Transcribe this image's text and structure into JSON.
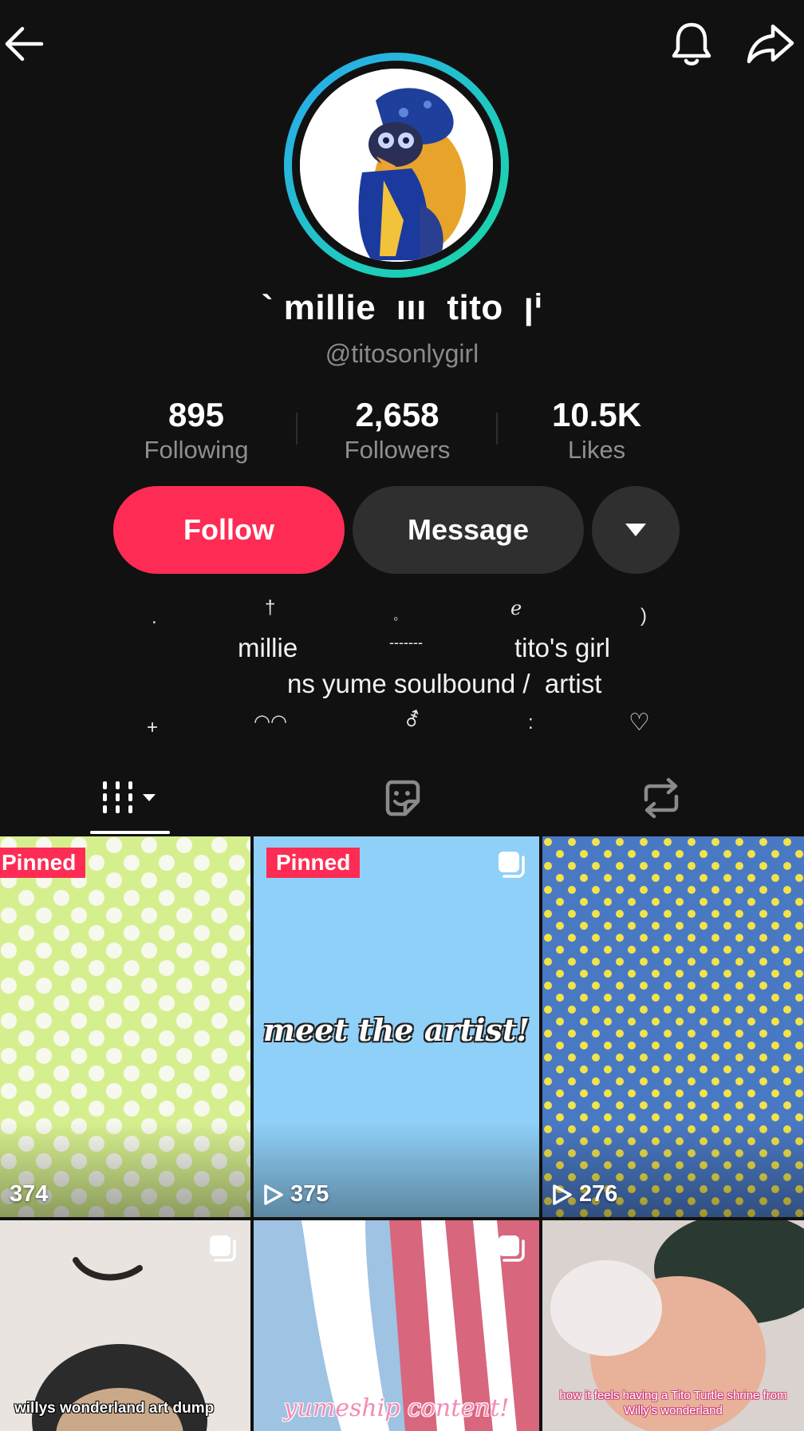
{
  "header": {
    "back_icon": "arrow-left-icon",
    "bell_icon": "bell-icon",
    "share_icon": "share-arrow-icon"
  },
  "profile": {
    "display_name": "` millie  ııı  tito  ןⁱ",
    "username": "@titosonlygirl",
    "ring_colors": [
      "#2aa8f0",
      "#18d6a6"
    ]
  },
  "stats": [
    {
      "value": "895",
      "label": "Following"
    },
    {
      "value": "2,658",
      "label": "Followers"
    },
    {
      "value": "10.5K",
      "label": "Likes"
    }
  ],
  "actions": {
    "follow_label": "Follow",
    "message_label": "Message",
    "follow_color": "#fe2c55"
  },
  "bio": {
    "line1": {
      "a": ".",
      "b": "†",
      "c": "◦",
      "d": "ℯ",
      "e": ")"
    },
    "line2": {
      "a": "millie",
      "b": "-------",
      "c": "tito's girl"
    },
    "line3": "ns yume soulbound /  artist",
    "line4": {
      "a": "+",
      "b": "◠◠",
      "c": "⚦",
      "d": ":",
      "e": "♡"
    }
  },
  "tabs": [
    {
      "name": "videos",
      "icon": "grid-bars-icon"
    },
    {
      "name": "favorites",
      "icon": "sticker-icon"
    },
    {
      "name": "reposts",
      "icon": "repost-icon"
    }
  ],
  "grid": [
    {
      "pinned": "Pinned",
      "views": "374",
      "caption": ""
    },
    {
      "pinned": "Pinned",
      "views": "375",
      "caption": "meet the artist!"
    },
    {
      "pinned": "",
      "views": "276",
      "caption": ""
    },
    {
      "pinned": "",
      "views": "",
      "caption": "willys wonderland art dump"
    },
    {
      "pinned": "",
      "views": "",
      "caption": "yumeship content!"
    },
    {
      "pinned": "",
      "views": "",
      "caption": "how it feels having a Tito Turtle shrine from Willy's wonderland"
    }
  ]
}
